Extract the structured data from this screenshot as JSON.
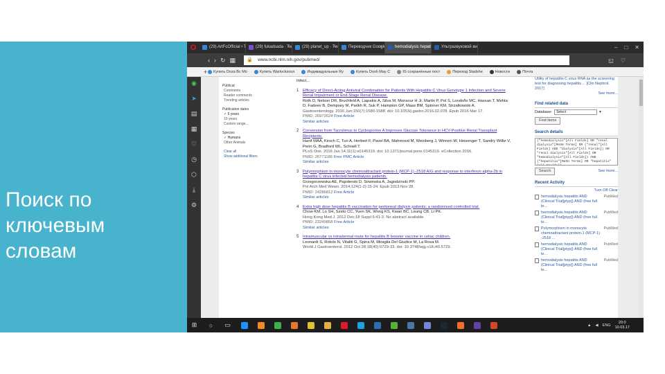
{
  "slide": {
    "title_lines": [
      "Поиск по",
      "ключевым",
      "словам"
    ],
    "accent_color": "#47b3cc"
  },
  "browser": {
    "tabs": [
      {
        "label": "(29) ArtFcOfficial · Twit",
        "active": false,
        "color": "#3a86d6"
      },
      {
        "label": "(29) fukadsada · Twitch",
        "active": false,
        "color": "#7a4fd1"
      },
      {
        "label": "(29) planet_up · Twitter",
        "active": false,
        "color": "#3a86d6"
      },
      {
        "label": "Переводчик Google",
        "active": false,
        "color": "#3a86d6"
      },
      {
        "label": "hemodialysis hepatitis",
        "active": true,
        "color": "#2a5aa0"
      },
      {
        "label": "Ультразвуковой анал",
        "active": false,
        "color": "#2a5aa0"
      }
    ],
    "url": "www.ncbi.nlm.nih.gov/pubmed/",
    "bookmarks": [
      {
        "label": "Купить Doza Bc Mo",
        "color": "#3a86d6"
      },
      {
        "label": "Купить Warlocksoun",
        "color": "#3a86d6"
      },
      {
        "label": "Индивидуальные Ry",
        "color": "#3a86d6"
      },
      {
        "label": "Купить Dosh May C",
        "color": "#3a86d6"
      },
      {
        "label": "IG сохранённые пост",
        "color": "#888"
      },
      {
        "label": "Переход Stadshe",
        "color": "#e0a030"
      },
      {
        "label": "Новости",
        "color": "#333"
      },
      {
        "label": "Почта",
        "color": "#555"
      }
    ]
  },
  "filters": {
    "groups": [
      {
        "items": [
          {
            "text": "Publicat",
            "cls": "hd"
          },
          {
            "text": "Comments",
            "cls": "it"
          },
          {
            "text": "Reader comments",
            "cls": "it"
          },
          {
            "text": "Trending articles",
            "cls": "it"
          }
        ]
      },
      {
        "items": [
          {
            "text": "Publication dates",
            "cls": "hd"
          },
          {
            "text": "✓ 5 years",
            "cls": "it chk"
          },
          {
            "text": "10 years",
            "cls": "it"
          },
          {
            "text": "Custom range...",
            "cls": "it"
          }
        ]
      },
      {
        "items": [
          {
            "text": "Species",
            "cls": "hd"
          },
          {
            "text": "✓ Humans",
            "cls": "it chk"
          },
          {
            "text": "Other Animals",
            "cls": "it"
          }
        ]
      },
      {
        "items": [
          {
            "text": "Clear all",
            "cls": "it link"
          },
          {
            "text": "Show additional filters",
            "cls": "it link"
          }
        ]
      }
    ]
  },
  "results": [
    {
      "num": "1",
      "title": "Efficacy of Direct-Acting Antiviral Combination for Patients With Hepatitis C Virus Genotype 1 Infection and Severe Renal Impairment or End-Stage Renal Disease.",
      "authors": "Roth D, Nelson DR, Bruchfeld A, Liapakis A, Silva M, Monsour H Jr, Martin P, Pol S, Londoño MC, Hassan T, Mehta D, Fadeev B, Dempsey M, Parikh R, Suk P, Hampton GP, Maas BM, Spinner KM, Strzalkowski A.",
      "source": "Gastroenterology. 2016 Jun;150(7):1580-1588. doi: 10.1053/j.gastro.2016.02.078. Epub 2016 Mar 17.",
      "pmid": "PMID: 26972624",
      "extra": "Free Article",
      "similar": "Similar articles"
    },
    {
      "num": "2",
      "title": "Conversion from Tacrolimus to Cyclosporine A Improves Glucose Tolerance in HCV-Positive Renal Transplant Recipients.",
      "authors": "Hanif MAA, Kirsch C, Turi A, Herbert F, Pavel BA, Mahmood M, Weinberg J, Winnen W, Heisenger T, Sandry Willie V, Perin G, Bradford WL, Schnell T.",
      "source": "PLoS One. 2016 Jan 14;11(1):e0145319. doi: 10.1371/journal.pone.0145319. eCollection 2016.",
      "pmid": "PMID: 26771186",
      "extra": "Free PMC Article",
      "similar": "Similar articles"
    },
    {
      "num": "3",
      "title": "Polymorphism in monocyte chemoattractant protein-1 (MCP-1) -2518 A/G and response to interferon alpha-2b in hepatitis C virus infected hemodialysis patients.",
      "authors": "Grzegorzewska AE, Pajzderski D, Sowinska A, Jagodzinski PP.",
      "source": "Pol Arch Med Wewn. 2014;124(1-2):15-24. Epub 2013 Nov 28.",
      "pmid": "PMID: 24286812",
      "extra": "Free Article",
      "similar": "Similar articles"
    },
    {
      "num": "4",
      "title": "Extra high dose hepatitis B vaccination for peritoneal dialysis patients: a randomised controlled trial.",
      "authors": "Chow KM, Lo SH, Szeto CC, Yuen SK, Wong KS, Kwan BC, Leung CB, Li PK.",
      "source": "Hong Kong Med J. 2012 Dec;18 Suppl 6:41-3. No abstract available.",
      "pmid": "PMID: 23249858",
      "extra": "Free Article",
      "similar": "Similar articles"
    },
    {
      "num": "5",
      "title": "Intramuscular vs intradermal route for hepatitis B booster vaccine in celiac children.",
      "authors": "Leonardi S, Rotolo N, Vitaliti G, Spina M, Miraglia Del Giudice M, La Rosa M.",
      "source": "World J Gastroenterol. 2012 Oct 28;18(40):5729-33. doi: 10.3748/wjg.v18.i40.5729.",
      "pmid": "",
      "extra": "",
      "similar": ""
    }
  ],
  "right": {
    "top_snippet": "Utility of hepatitis C virus RNA as the screening test for diagnosing hepatitis ... [Clin Nephrol. 2017]",
    "see_more_1": "See more...",
    "find_related_title": "Find related data",
    "database_label": "Database:",
    "database_value": "Select",
    "find_items_button": "Find items",
    "search_details_title": "Search details",
    "search_details_text": "(\"hemodialysis\"[All Fields] OR \"renal dialysis\"[MeSH Terms] OR (\"renal\"[All Fields] AND \"dialysis\"[All Fields]) OR \"renal dialysis\"[All Fields] OR \"hemodialysis\"[All Fields]) AND (\"hepatitis\"[MeSH Terms] OR \"hepatitis\"[All Fields])",
    "search_button": "Search",
    "see_more_2": "See more...",
    "recent_activity_title": "Recent Activity",
    "turn_off": "Turn Off  Clear",
    "activity": [
      {
        "text": "hemodialysis hepatitis AND (Clinical Trial[ptyp]) AND (free full te...",
        "tag": "PubMed"
      },
      {
        "text": "hemodialysis hepatitis AND (Clinical Trial[ptyp]) AND (free full te...",
        "tag": "PubMed"
      },
      {
        "text": "Polymorphism in monocyte chemoattractant protein-1 (MCP-1) -2518 ...",
        "tag": "PubMed"
      },
      {
        "text": "hemodialysis hepatitis AND (Clinical Trial[ptyp]) AND (free full te...",
        "tag": "PubMed"
      },
      {
        "text": "hemodialysis hepatitis AND (Clinical Trial[ptyp]) AND (free full te...",
        "tag": "PubMed"
      }
    ]
  },
  "taskbar": {
    "apps": [
      {
        "name": "ie-icon",
        "color": "#1e90ff"
      },
      {
        "name": "chart-app-icon",
        "color": "#f28c28"
      },
      {
        "name": "nero-icon",
        "color": "#3bb34a"
      },
      {
        "name": "firefox-icon",
        "color": "#e8762d"
      },
      {
        "name": "chrome-icon",
        "color": "#e0c030"
      },
      {
        "name": "folder-icon",
        "color": "#e0b040"
      },
      {
        "name": "opera-icon",
        "color": "#e0182d"
      },
      {
        "name": "skype-icon",
        "color": "#1fa0e0"
      },
      {
        "name": "teamspeak-icon",
        "color": "#2a6fb0"
      },
      {
        "name": "torrent-icon",
        "color": "#58b03a"
      },
      {
        "name": "vk-icon",
        "color": "#4a76a8"
      },
      {
        "name": "discord-icon",
        "color": "#7289da"
      },
      {
        "name": "steam-icon",
        "color": "#1b2838"
      },
      {
        "name": "origin-icon",
        "color": "#f56c2d"
      },
      {
        "name": "twitch-icon",
        "color": "#6441a5"
      },
      {
        "name": "powerpoint-icon",
        "color": "#d24726"
      }
    ],
    "lang": "ENG",
    "time": "20:0",
    "date": "10.03.17"
  }
}
